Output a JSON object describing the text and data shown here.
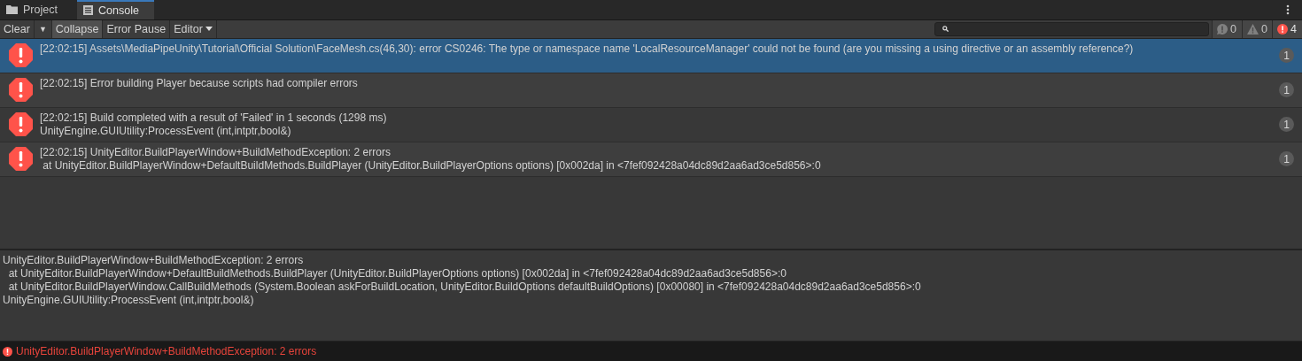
{
  "tabs": [
    {
      "label": "Project",
      "kind": "folder",
      "selected": false
    },
    {
      "label": "Console",
      "kind": "console",
      "selected": true
    }
  ],
  "toolbar": {
    "buttons": [
      {
        "label": "Clear",
        "kind": "button",
        "selected": false
      },
      {
        "label": "▼",
        "kind": "dropdown",
        "selected": false
      },
      {
        "label": "Collapse",
        "kind": "toggle",
        "selected": true
      },
      {
        "label": "Error Pause",
        "kind": "toggle",
        "selected": false
      },
      {
        "label": "Editor",
        "kind": "menu",
        "selected": false
      }
    ],
    "counters": [
      {
        "kind": "info",
        "count": "0",
        "selected": false
      },
      {
        "kind": "warning",
        "count": "0",
        "selected": false
      },
      {
        "kind": "error",
        "count": "4",
        "selected": true
      }
    ]
  },
  "messages": [
    {
      "lines": [
        "[22:02:15] Assets\\MediaPipeUnity\\Tutorial\\Official Solution\\FaceMesh.cs(46,30): error CS0246: The type or namespace name 'LocalResourceManager' could not be found (are you missing a using directive or an assembly reference?)"
      ],
      "count": "1",
      "selected": true
    },
    {
      "lines": [
        "[22:02:15] Error building Player because scripts had compiler errors"
      ],
      "count": "1",
      "selected": false
    },
    {
      "lines": [
        "[22:02:15] Build completed with a result of 'Failed' in 1 seconds (1298 ms)",
        "UnityEngine.GUIUtility:ProcessEvent (int,intptr,bool&)"
      ],
      "count": "1",
      "selected": false
    },
    {
      "lines": [
        "[22:02:15] UnityEditor.BuildPlayerWindow+BuildMethodException: 2 errors",
        " at UnityEditor.BuildPlayerWindow+DefaultBuildMethods.BuildPlayer (UnityEditor.BuildPlayerOptions options) [0x002da] in <7fef092428a04dc89d2aa6ad3ce5d856>:0"
      ],
      "count": "1",
      "selected": false
    }
  ],
  "detail": [
    "UnityEditor.BuildPlayerWindow+BuildMethodException: 2 errors",
    "  at UnityEditor.BuildPlayerWindow+DefaultBuildMethods.BuildPlayer (UnityEditor.BuildPlayerOptions options) [0x002da] in <7fef092428a04dc89d2aa6ad3ce5d856>:0",
    "  at UnityEditor.BuildPlayerWindow.CallBuildMethods (System.Boolean askForBuildLocation, UnityEditor.BuildOptions defaultBuildOptions) [0x00080] in <7fef092428a04dc89d2aa6ad3ce5d856>:0",
    "UnityEngine.GUIUtility:ProcessEvent (int,intptr,bool&)"
  ],
  "status_bar": {
    "text": "UnityEditor.BuildPlayerWindow+BuildMethodException: 2 errors"
  }
}
